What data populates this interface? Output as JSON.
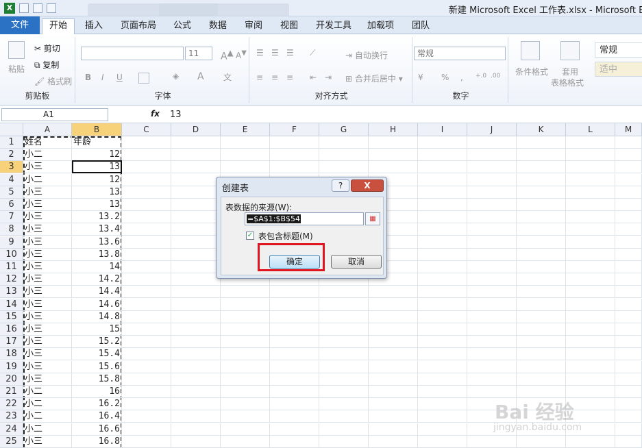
{
  "window": {
    "title": "新建 Microsoft Excel 工作表.xlsx - Microsoft Excel"
  },
  "tabs": [
    {
      "label": "文件"
    },
    {
      "label": "开始"
    },
    {
      "label": "插入"
    },
    {
      "label": "页面布局"
    },
    {
      "label": "公式"
    },
    {
      "label": "数据"
    },
    {
      "label": "审阅"
    },
    {
      "label": "视图"
    },
    {
      "label": "开发工具"
    },
    {
      "label": "加载项"
    },
    {
      "label": "团队"
    }
  ],
  "ribbon": {
    "clipboard": {
      "label": "剪贴板",
      "paste": "粘贴",
      "cut": "剪切",
      "copy": "复制",
      "format_painter": "格式刷"
    },
    "font": {
      "label": "字体",
      "size": "11"
    },
    "alignment": {
      "label": "对齐方式",
      "wrap": "自动换行",
      "merge": "合并后居中"
    },
    "number": {
      "label": "数字",
      "format": "常规"
    },
    "styles": {
      "conditional": "条件格式",
      "table_format_1": "套用",
      "table_format_2": "表格格式",
      "style_normal": "常规",
      "style_medium": "适中"
    }
  },
  "formula_bar": {
    "name_box": "A1",
    "fx": "fx",
    "value": "13"
  },
  "columns": [
    "A",
    "B",
    "C",
    "D",
    "E",
    "F",
    "G",
    "H",
    "I",
    "J",
    "K",
    "L",
    "M"
  ],
  "rows": [
    {
      "n": "1",
      "a": "姓名",
      "b": "年龄"
    },
    {
      "n": "2",
      "a": "小二",
      "b": "12"
    },
    {
      "n": "3",
      "a": "小三",
      "b": "13"
    },
    {
      "n": "4",
      "a": "小二",
      "b": "12"
    },
    {
      "n": "5",
      "a": "小三",
      "b": "13"
    },
    {
      "n": "6",
      "a": "小三",
      "b": "13"
    },
    {
      "n": "7",
      "a": "小三",
      "b": "13.2"
    },
    {
      "n": "8",
      "a": "小三",
      "b": "13.4"
    },
    {
      "n": "9",
      "a": "小三",
      "b": "13.6"
    },
    {
      "n": "10",
      "a": "小三",
      "b": "13.8"
    },
    {
      "n": "11",
      "a": "小三",
      "b": "14"
    },
    {
      "n": "12",
      "a": "小三",
      "b": "14.2"
    },
    {
      "n": "13",
      "a": "小三",
      "b": "14.4"
    },
    {
      "n": "14",
      "a": "小三",
      "b": "14.6"
    },
    {
      "n": "15",
      "a": "小三",
      "b": "14.8"
    },
    {
      "n": "16",
      "a": "小三",
      "b": "15"
    },
    {
      "n": "17",
      "a": "小三",
      "b": "15.2"
    },
    {
      "n": "18",
      "a": "小三",
      "b": "15.4"
    },
    {
      "n": "19",
      "a": "小三",
      "b": "15.6"
    },
    {
      "n": "20",
      "a": "小三",
      "b": "15.8"
    },
    {
      "n": "21",
      "a": "小二",
      "b": "16"
    },
    {
      "n": "22",
      "a": "小二",
      "b": "16.2"
    },
    {
      "n": "23",
      "a": "小二",
      "b": "16.4"
    },
    {
      "n": "24",
      "a": "小二",
      "b": "16.6"
    },
    {
      "n": "25",
      "a": "小三",
      "b": "16.8"
    }
  ],
  "dialog": {
    "title": "创建表",
    "help": "?",
    "close": "X",
    "source_label": "表数据的来源(W):",
    "source_value": "=$A$1:$B$54",
    "has_headers": "表包含标题(M)",
    "ok": "确定",
    "cancel": "取消"
  },
  "watermark": {
    "text": "Bai 经验",
    "sub": "jingyan.baidu.com"
  }
}
